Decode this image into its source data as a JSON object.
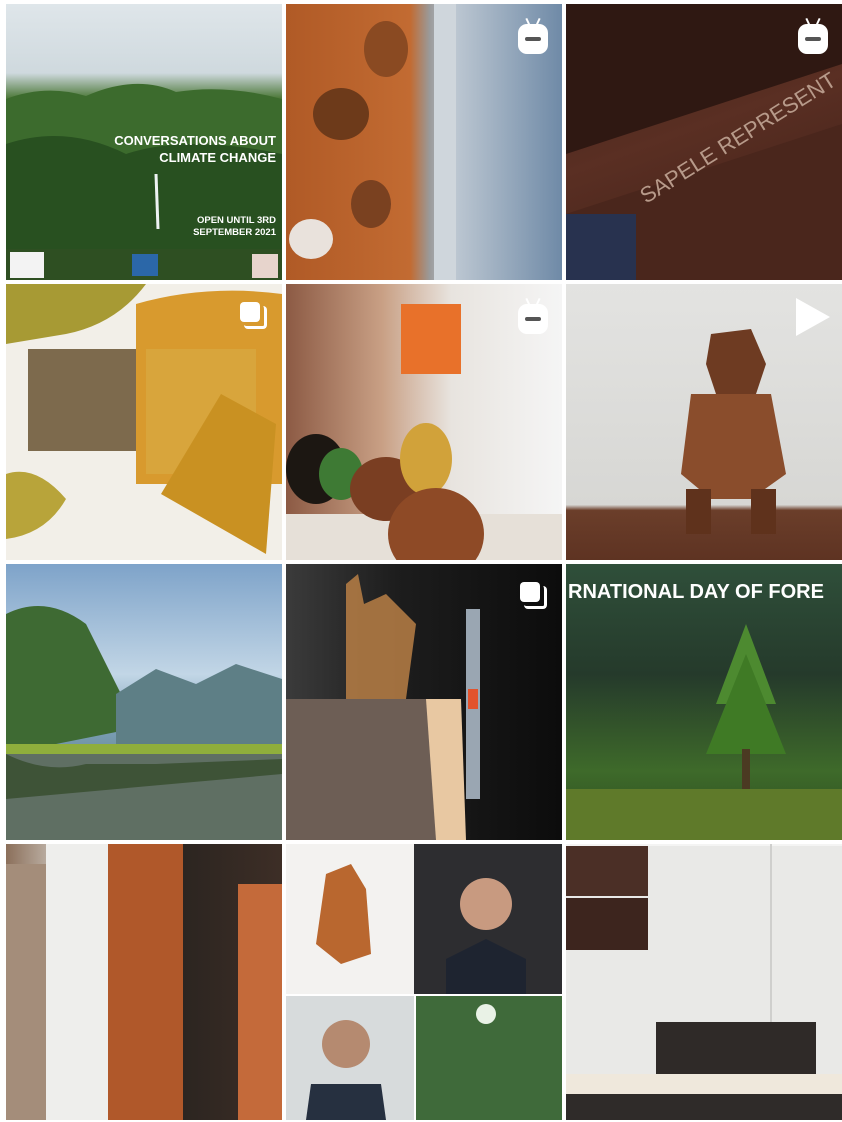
{
  "tiles": [
    {
      "id": "climate-poster",
      "title_line1": "CONVERSATIONS ABOUT",
      "title_line2": "CLIMATE CHANGE",
      "dates_line1": "OPEN UNTIL 3RD",
      "dates_line2": "SEPTEMBER 2021",
      "badge": "none"
    },
    {
      "id": "perforated-wood-closeup",
      "badge": "igtv-icon"
    },
    {
      "id": "engraved-wood-block",
      "engraving": "SAPELE REPRESENT",
      "badge": "igtv-icon"
    },
    {
      "id": "wood-veneer-samples",
      "badge": "carousel-icon"
    },
    {
      "id": "wooden-eggs",
      "badge": "igtv-icon"
    },
    {
      "id": "wooden-gorilla",
      "badge": "play-icon"
    },
    {
      "id": "lake-mountains",
      "badge": "none"
    },
    {
      "id": "wood-silhouette-model",
      "badge": "carousel-icon"
    },
    {
      "id": "forests-day",
      "headline": "RNATIONAL DAY OF FORE",
      "badge": "none"
    },
    {
      "id": "timber-columns",
      "badge": "none"
    },
    {
      "id": "portrait-collage",
      "badge": "none"
    },
    {
      "id": "wall-sign",
      "badge": "none"
    }
  ],
  "colors": {
    "background": "#ffffff",
    "icon": "#ffffff"
  }
}
